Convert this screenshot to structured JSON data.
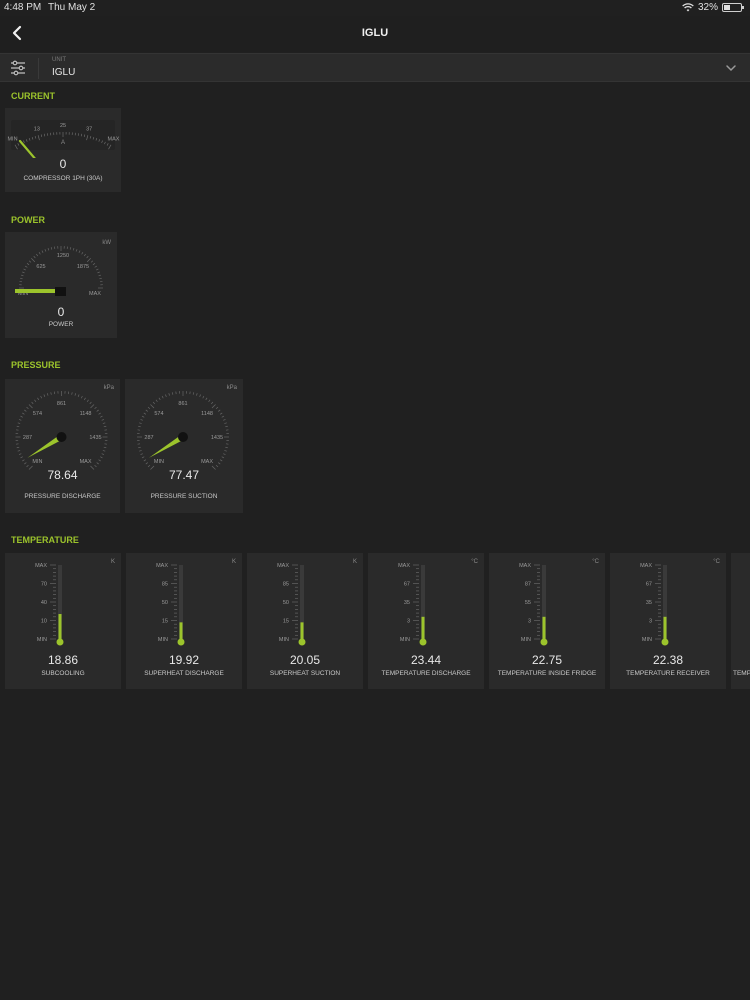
{
  "status_bar": {
    "time": "4:48 PM",
    "date": "Thu May 2",
    "battery": "32%",
    "battery_level": 0.32
  },
  "nav": {
    "title": "IGLU"
  },
  "unit_selector": {
    "label": "UNIT",
    "value": "IGLU"
  },
  "sections": {
    "current": "CURRENT",
    "power": "POWER",
    "pressure": "PRESSURE",
    "temperature": "TEMPERATURE"
  },
  "current_gauge": {
    "name": "COMPRESSOR 1PH (30A)",
    "value": "0",
    "unit": "A",
    "ticks": [
      "MIN",
      "13",
      "25",
      "37",
      "MAX"
    ]
  },
  "power_gauge": {
    "name": "POWER",
    "value": "0",
    "unit": "kW",
    "ticks": [
      "MIN",
      "625",
      "1250",
      "1875",
      "MAX"
    ]
  },
  "pressure_gauges": [
    {
      "name": "PRESSURE DISCHARGE",
      "value": "78.64",
      "unit": "kPa",
      "ticks": [
        "MIN",
        "287",
        "574",
        "861",
        "1148",
        "1435",
        "MAX"
      ]
    },
    {
      "name": "PRESSURE SUCTION",
      "value": "77.47",
      "unit": "kPa",
      "ticks": [
        "MIN",
        "287",
        "574",
        "861",
        "1148",
        "1435",
        "MAX"
      ]
    }
  ],
  "temperature_gauges": [
    {
      "name": "SUBCOOLING",
      "value": "18.86",
      "unit": "K",
      "ticks": [
        "MAX",
        "70",
        "40",
        "10",
        "MIN"
      ],
      "level": 0.45
    },
    {
      "name": "SUPERHEAT DISCHARGE",
      "value": "19.92",
      "unit": "K",
      "ticks": [
        "MAX",
        "85",
        "50",
        "15",
        "MIN"
      ],
      "level": 0.3
    },
    {
      "name": "SUPERHEAT SUCTION",
      "value": "20.05",
      "unit": "K",
      "ticks": [
        "MAX",
        "85",
        "50",
        "15",
        "MIN"
      ],
      "level": 0.3
    },
    {
      "name": "TEMPERATURE DISCHARGE",
      "value": "23.44",
      "unit": "°C",
      "ticks": [
        "MAX",
        "67",
        "35",
        "3",
        "MIN"
      ],
      "level": 0.4
    },
    {
      "name": "TEMPERATURE INSIDE FRIDGE",
      "value": "22.75",
      "unit": "°C",
      "ticks": [
        "MAX",
        "87",
        "55",
        "3",
        "MIN"
      ],
      "level": 0.4
    },
    {
      "name": "TEMPERATURE RECEIVER",
      "value": "22.38",
      "unit": "°C",
      "ticks": [
        "MAX",
        "67",
        "35",
        "3",
        "MIN"
      ],
      "level": 0.4
    },
    {
      "name": "TEMPE",
      "value": "",
      "unit": "",
      "ticks": [],
      "level": 0
    }
  ],
  "colors": {
    "accent": "#9cc42c",
    "background": "#202020",
    "card": "#2a2a2a"
  }
}
